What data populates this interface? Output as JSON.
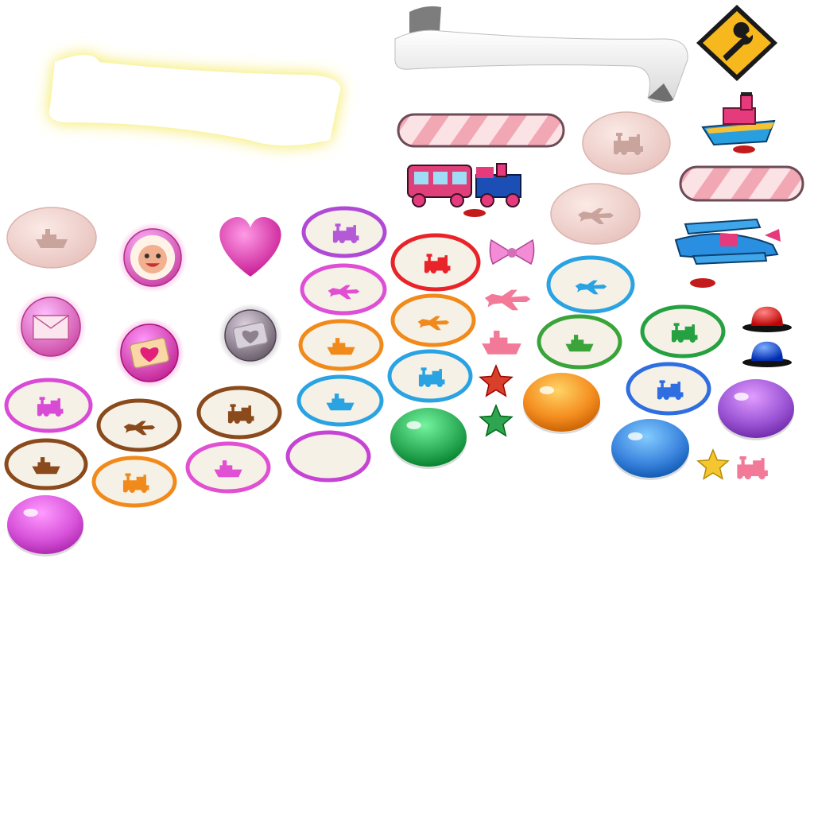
{
  "sheet": {
    "background": "#ffffff",
    "sprites": [
      {
        "id": "banner-glow",
        "type": "banner-glow",
        "color": "#f4e74a"
      },
      {
        "id": "banner-ribbon",
        "type": "banner-ribbon",
        "color": "#f0f0f0"
      },
      {
        "id": "wrench-sign",
        "type": "wrench-sign",
        "color": "#f7b81d"
      },
      {
        "id": "toy-boat",
        "type": "toy-boat",
        "color": "#2da7e6"
      },
      {
        "id": "candy-bar-1",
        "type": "candy-bar",
        "color": "#f2a7b4"
      },
      {
        "id": "candy-bar-2",
        "type": "candy-bar",
        "color": "#f2a7b4"
      },
      {
        "id": "bubble-train",
        "type": "pale-bubble",
        "icon": "train",
        "color": "#f3d3cf"
      },
      {
        "id": "bubble-plane",
        "type": "pale-bubble",
        "icon": "plane",
        "color": "#f3d3cf"
      },
      {
        "id": "bubble-boat",
        "type": "pale-bubble",
        "icon": "boat",
        "color": "#f3d3cf"
      },
      {
        "id": "toy-train",
        "type": "toy-train",
        "color": "#e0407a"
      },
      {
        "id": "toy-plane",
        "type": "toy-plane",
        "color": "#2da7e6"
      },
      {
        "id": "bow",
        "type": "bow",
        "color": "#f38bd6"
      },
      {
        "id": "pink-plane-icon",
        "type": "silhouette",
        "icon": "plane",
        "color": "#f27a98"
      },
      {
        "id": "pink-boat-icon",
        "type": "silhouette",
        "icon": "boat",
        "color": "#f27a98"
      },
      {
        "id": "pink-train-icon",
        "type": "silhouette",
        "icon": "train",
        "color": "#f27a98"
      },
      {
        "id": "star-red",
        "type": "star",
        "color": "#d8402a"
      },
      {
        "id": "star-green",
        "type": "star",
        "color": "#2fa451"
      },
      {
        "id": "star-gold",
        "type": "star",
        "color": "#f4c630"
      },
      {
        "id": "dome-red",
        "type": "dome",
        "color": "#e52b2b"
      },
      {
        "id": "dome-blue",
        "type": "dome",
        "color": "#2453d6"
      },
      {
        "id": "gumdrop-orange",
        "type": "gumdrop",
        "color": "#f58e20"
      },
      {
        "id": "gumdrop-green",
        "type": "gumdrop",
        "color": "#2fae5a"
      },
      {
        "id": "gumdrop-blue",
        "type": "gumdrop",
        "color": "#3d86df"
      },
      {
        "id": "gumdrop-purple",
        "type": "gumdrop",
        "color": "#9c56d6"
      },
      {
        "id": "gumdrop-magenta",
        "type": "gumdrop",
        "color": "#d955dc"
      },
      {
        "id": "gift-orb-santa",
        "type": "gift-orb",
        "icon": "santa",
        "color": "#f068c8"
      },
      {
        "id": "gift-orb-heart",
        "type": "heart",
        "color": "#e83dba"
      },
      {
        "id": "gift-orb-mail",
        "type": "gift-orb",
        "icon": "mail",
        "color": "#f26fc9"
      },
      {
        "id": "gift-orb-ticket",
        "type": "gift-orb",
        "icon": "ticket",
        "color": "#e84ab7"
      },
      {
        "id": "gift-orb-grey",
        "type": "gift-orb",
        "icon": "ticket-grey",
        "color": "#8d8190"
      },
      {
        "id": "badge-purple-train",
        "type": "badge",
        "icon": "train",
        "color": "#b55ad6",
        "ring": "#b049d6"
      },
      {
        "id": "badge-pink-plane",
        "type": "badge",
        "icon": "plane",
        "color": "#e14fd3",
        "ring": "#df4fd6"
      },
      {
        "id": "badge-orange-boat",
        "type": "badge",
        "icon": "boat",
        "color": "#f18a1b",
        "ring": "#f18a1b"
      },
      {
        "id": "badge-blue-boat",
        "type": "badge",
        "icon": "boat",
        "color": "#2aa3e2",
        "ring": "#2aa3e2"
      },
      {
        "id": "badge-empty",
        "type": "badge",
        "icon": "none",
        "color": "#c644d4",
        "ring": "#c644d4"
      },
      {
        "id": "badge-red-train",
        "type": "badge",
        "icon": "train",
        "color": "#e8242a",
        "ring": "#e8242a"
      },
      {
        "id": "badge-orange-plane",
        "type": "badge",
        "icon": "plane",
        "color": "#f18a1b",
        "ring": "#f18a1b"
      },
      {
        "id": "badge-blue-train",
        "type": "badge",
        "icon": "train",
        "color": "#2aa3e2",
        "ring": "#2aa3e2"
      },
      {
        "id": "badge-blue-plane",
        "type": "badge",
        "icon": "plane",
        "color": "#2aa3e2",
        "ring": "#2aa3e2"
      },
      {
        "id": "badge-green-boat",
        "type": "badge",
        "icon": "boat",
        "color": "#3aa43a",
        "ring": "#3aa43a"
      },
      {
        "id": "badge-green-train",
        "type": "badge",
        "icon": "train",
        "color": "#25a141",
        "ring": "#25a141"
      },
      {
        "id": "badge-blue-train-2",
        "type": "badge",
        "icon": "train",
        "color": "#2f6ee0",
        "ring": "#2f6ee0"
      },
      {
        "id": "badge-magenta-train",
        "type": "badge",
        "icon": "train",
        "color": "#d94ad6",
        "ring": "#d94ad6"
      },
      {
        "id": "badge-brown-plane",
        "type": "badge",
        "icon": "plane",
        "color": "#8a4a1c",
        "ring": "#8a4a1c"
      },
      {
        "id": "badge-brown-train",
        "type": "badge",
        "icon": "train",
        "color": "#8a4a1c",
        "ring": "#8a4a1c"
      },
      {
        "id": "badge-brown-boat",
        "type": "badge",
        "icon": "boat",
        "color": "#8a4a1c",
        "ring": "#8a4a1c"
      },
      {
        "id": "badge-orange-train",
        "type": "badge",
        "icon": "train",
        "color": "#f18a1b",
        "ring": "#f18a1b"
      },
      {
        "id": "badge-pink-boat",
        "type": "badge",
        "icon": "boat",
        "color": "#e14fd3",
        "ring": "#e14fd3"
      }
    ]
  }
}
